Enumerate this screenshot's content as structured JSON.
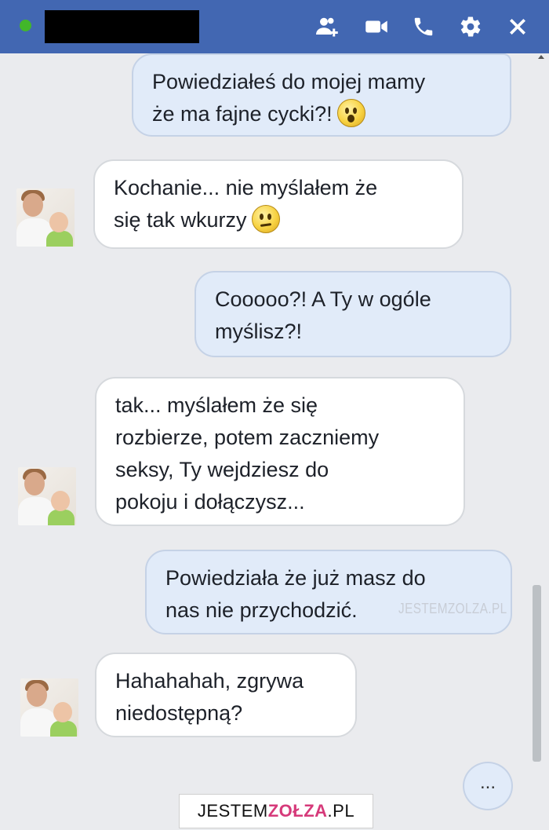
{
  "header": {
    "add_people_icon": "add-people-icon",
    "video_icon": "video-call-icon",
    "phone_icon": "phone-icon",
    "settings_icon": "gear-icon",
    "close_icon": "close-icon"
  },
  "messages": [
    {
      "side": "out",
      "line1": "Powiedziałeś do mojej mamy",
      "line2": "że ma fajne cycki?!",
      "emoji": "surprised"
    },
    {
      "side": "in",
      "line1": "Kochanie... nie myślałem że",
      "line2": "się tak wkurzy",
      "emoji": "frown"
    },
    {
      "side": "out",
      "line1": "Cooooo?! A Ty w ogóle",
      "line2": "myślisz?!"
    },
    {
      "side": "in",
      "line1": "tak... myślałem że się",
      "line2": "rozbierze, potem zaczniemy",
      "line3": "seksy, Ty wejdziesz do",
      "line4": "pokoju i dołączysz..."
    },
    {
      "side": "out",
      "line1": "Powiedziała że już masz do",
      "line2": "nas nie przychodzić."
    },
    {
      "side": "in",
      "line1": "Hahahahah, zgrywa",
      "line2": "niedostępną?"
    }
  ],
  "typing": "...",
  "watermark": "JESTEMZOLZA.PL",
  "footer_logo": {
    "part1": "JESTEM",
    "part2": "ZOŁZA",
    "part3": ".PL"
  },
  "colors": {
    "header": "#4267b2",
    "outgoing_bubble": "#e1ebf9",
    "incoming_bubble": "#ffffff",
    "online": "#42b72a"
  }
}
